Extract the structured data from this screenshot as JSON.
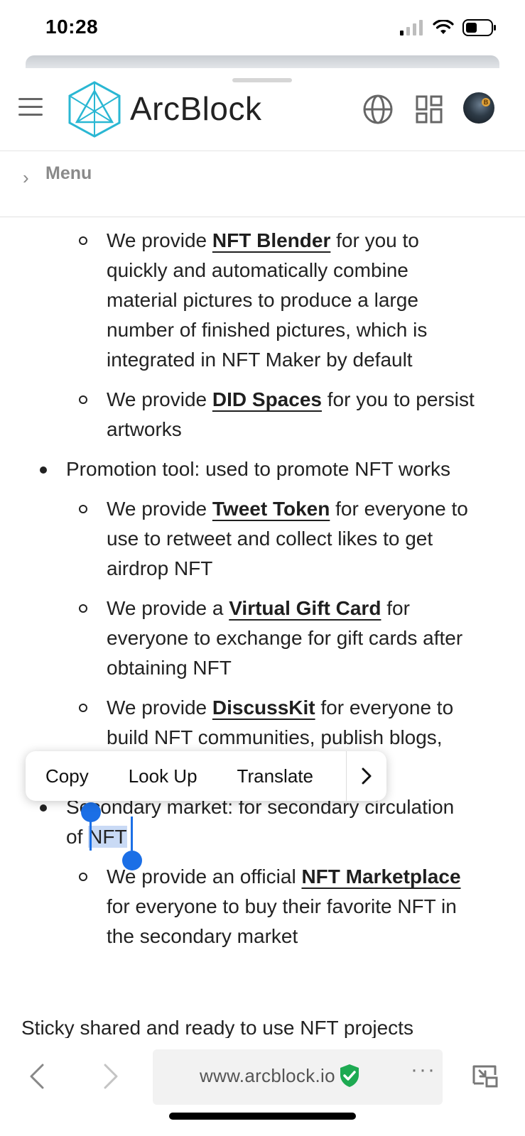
{
  "status_bar": {
    "time": "10:28"
  },
  "header": {
    "brand": "ArcBlock"
  },
  "breadcrumb": {
    "label": "Menu"
  },
  "content": {
    "blender": {
      "pre": "We provide ",
      "link": "NFT Blender",
      "l1": " for you to",
      "l2": "quickly and automatically combine",
      "l3": "material pictures to produce a large",
      "l4": "number of finished pictures, which is",
      "l5": "integrated in NFT Maker by default"
    },
    "spaces": {
      "pre": "We provide ",
      "link": "DID Spaces",
      "l1": " for you to persist",
      "l2": "artworks"
    },
    "promotion": "Promotion tool: used to promote NFT works",
    "tweet": {
      "pre": "We provide ",
      "link": "Tweet Token",
      "l1": " for everyone to",
      "l2": "use to retweet and collect likes to get",
      "l3": "airdrop NFT"
    },
    "gift": {
      "pre": "We provide a ",
      "link": "Virtual Gift Card",
      "l1": " for",
      "l2": "everyone to exchange for gift cards after",
      "l3": "obtaining NFT"
    },
    "discuss": {
      "pre": "We provide ",
      "link": "DiscussKit",
      "l1": " for everyone to",
      "l2": "build NFT communities, publish blogs,"
    },
    "secondary": {
      "l1": "Secondary market: for secondary circulation",
      "pre2": "of ",
      "sel": "NFT"
    },
    "market": {
      "pre": "We provide an official ",
      "link": "NFT Marketplace",
      "l2": "for everyone to buy their favorite NFT in",
      "l3": "the secondary market"
    },
    "cut_line": "Sticky shared and ready to use NFT projects"
  },
  "context_menu": {
    "copy": "Copy",
    "lookup": "Look Up",
    "translate": "Translate"
  },
  "toolbar": {
    "url": "www.arcblock.io"
  }
}
